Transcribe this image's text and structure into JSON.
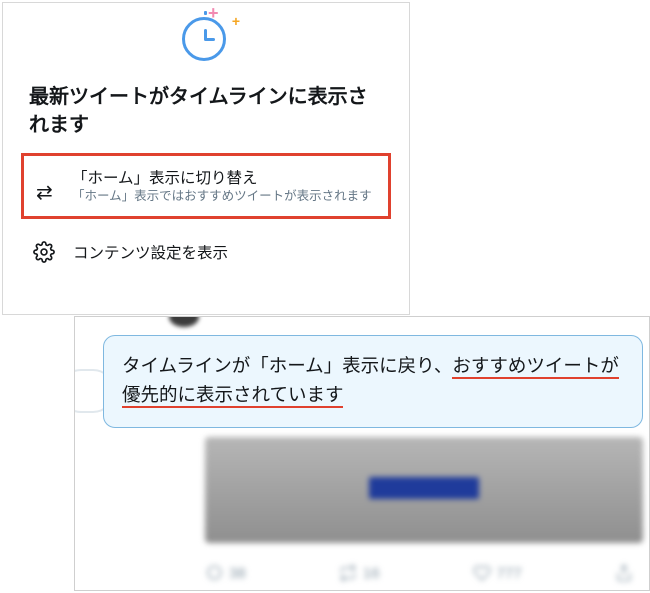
{
  "popup": {
    "title": "最新ツイートがタイムラインに表示されます",
    "switch": {
      "label": "「ホーム」表示に切り替え",
      "description": "「ホーム」表示ではおすすめツイートが表示されます"
    },
    "settings_label": "コンテンツ設定を表示"
  },
  "bubble": {
    "text_before": "タイムラインが「ホーム」表示に戻り、",
    "highlight": "おすすめツイートが優先的に表示されています"
  },
  "blurred_actions": {
    "reply_count": "38",
    "retweet_count": "16",
    "like_count": "777"
  }
}
